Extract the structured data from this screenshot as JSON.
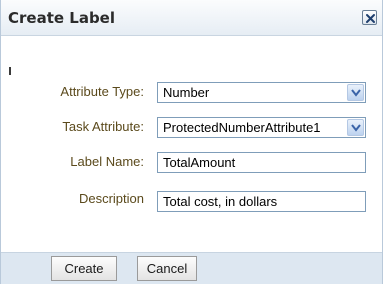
{
  "dialog": {
    "title": "Create Label",
    "fields": [
      {
        "label": "Attribute Type:",
        "value": "Number",
        "kind": "select"
      },
      {
        "label": "Task Attribute:",
        "value": "ProtectedNumberAttribute1",
        "kind": "select"
      },
      {
        "label": "Label Name:",
        "value": "TotalAmount",
        "kind": "text"
      },
      {
        "label": "Description",
        "value": "Total cost, in dollars",
        "kind": "text"
      }
    ],
    "buttons": {
      "create": "Create",
      "cancel": "Cancel"
    }
  },
  "icons": {
    "close": "close-icon",
    "dropdown": "chevron-down-icon"
  },
  "colors": {
    "label_text": "#5b4a1c",
    "field_border": "#7f9db9",
    "footer_bg": "#dde7f1",
    "dropdown_arrow": "#3a63a8"
  }
}
